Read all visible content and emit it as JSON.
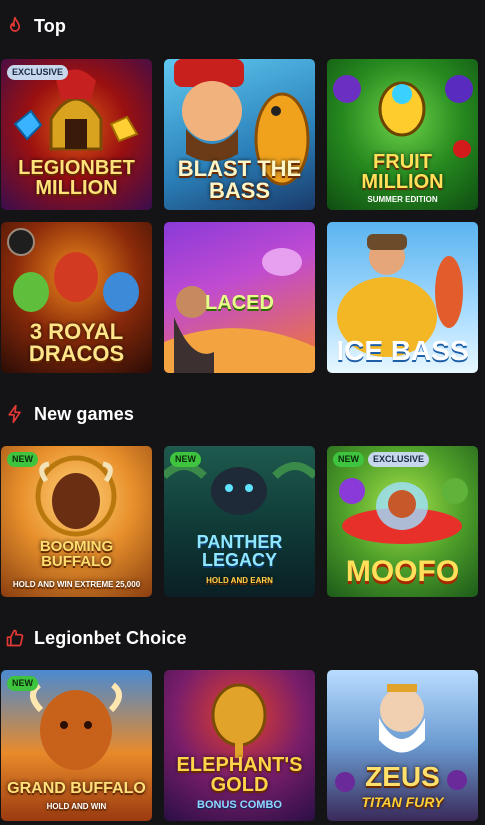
{
  "colors": {
    "accent": "#e53935",
    "badge_new": "#3ec43e",
    "badge_exclusive": "#c7d8ec",
    "background": "#141316"
  },
  "sections": [
    {
      "title": "Top",
      "icon": "flame-icon",
      "games": [
        {
          "name": "LEGIONBET MILLION",
          "badges": [
            "EXCLUSIVE"
          ]
        },
        {
          "name": "BLAST THE BASS",
          "badges": []
        },
        {
          "name": "FRUIT MILLION",
          "subtitle": "SUMMER EDITION",
          "badges": []
        },
        {
          "name": "3 ROYAL DRACOS",
          "badges": []
        },
        {
          "name": "LACED",
          "badges": []
        },
        {
          "name": "ICE BASS",
          "badges": []
        }
      ]
    },
    {
      "title": "New games",
      "icon": "lightning-icon",
      "games": [
        {
          "name": "BOOMING BUFFALO",
          "subtitle": "HOLD AND WIN EXTREME 25,000",
          "badges": [
            "NEW"
          ]
        },
        {
          "name": "PANTHER LEGACY",
          "subtitle": "HOLD AND EARN",
          "badges": [
            "NEW"
          ]
        },
        {
          "name": "MOOFO",
          "badges": [
            "NEW",
            "EXCLUSIVE"
          ]
        }
      ]
    },
    {
      "title": "Legionbet Choice",
      "icon": "thumbs-up-icon",
      "games": [
        {
          "name": "GRAND BUFFALO",
          "subtitle": "HOLD AND WIN",
          "badges": [
            "NEW"
          ]
        },
        {
          "name": "ELEPHANT'S GOLD",
          "subtitle": "BONUS COMBO",
          "badges": []
        },
        {
          "name": "ZEUS",
          "subtitle": "TITAN FURY",
          "badges": []
        }
      ]
    }
  ]
}
